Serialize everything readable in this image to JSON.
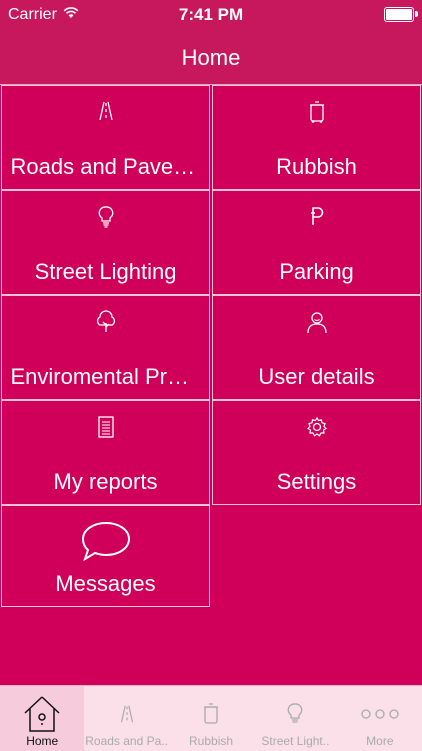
{
  "status": {
    "carrier": "Carrier",
    "time": "7:41 PM"
  },
  "nav": {
    "title": "Home"
  },
  "tiles": [
    {
      "label": "Roads and Pavements",
      "icon": "road-icon"
    },
    {
      "label": "Rubbish",
      "icon": "bin-icon"
    },
    {
      "label": "Street Lighting",
      "icon": "lightbulb-icon"
    },
    {
      "label": "Parking",
      "icon": "parking-icon"
    },
    {
      "label": "Enviromental Protection",
      "icon": "tree-icon"
    },
    {
      "label": "User details",
      "icon": "user-icon"
    },
    {
      "label": "My reports",
      "icon": "document-icon"
    },
    {
      "label": "Settings",
      "icon": "gear-icon"
    },
    {
      "label": "Messages",
      "icon": "speech-bubble-icon"
    }
  ],
  "tabs": [
    {
      "label": "Home",
      "icon": "birdhouse-icon",
      "active": true
    },
    {
      "label": "Roads and Pa..",
      "icon": "road-icon"
    },
    {
      "label": "Rubbish",
      "icon": "bin-icon"
    },
    {
      "label": "Street Light..",
      "icon": "lightbulb-icon"
    },
    {
      "label": "More",
      "icon": "more-dots-icon"
    }
  ],
  "colors": {
    "primary": "#d0005a",
    "bar": "#c8185d",
    "tab_bg": "#fbe0ea"
  }
}
